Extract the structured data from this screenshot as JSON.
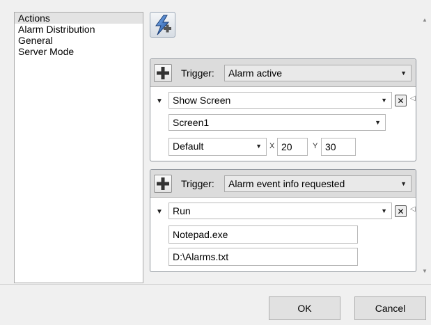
{
  "categories": [
    {
      "label": "Actions",
      "selected": true
    },
    {
      "label": "Alarm Distribution",
      "selected": false
    },
    {
      "label": "General",
      "selected": false
    },
    {
      "label": "Server Mode",
      "selected": false
    }
  ],
  "icons": {
    "add_action": "lightning-plus-icon",
    "add_trigger": "plus-icon",
    "delete": "close-icon",
    "collapse": "triangle-down-icon",
    "dropdown": "triangle-down-icon",
    "scroll_up": "triangle-up-icon",
    "scroll_down": "triangle-down-icon"
  },
  "triggers": [
    {
      "label": "Trigger:",
      "value": "Alarm active",
      "action": {
        "type": "Show Screen",
        "screen": "Screen1",
        "position": "Default",
        "x_label": "X",
        "x_value": "20",
        "y_label": "Y",
        "y_value": "30"
      }
    },
    {
      "label": "Trigger:",
      "value": "Alarm event info requested",
      "action": {
        "type": "Run",
        "program": "Notepad.exe",
        "arguments": "D:\\Alarms.txt"
      }
    }
  ],
  "footer": {
    "ok_label": "OK",
    "cancel_label": "Cancel"
  },
  "colors": {
    "window_bg": "#f0f0f0",
    "panel_header": "#dcdcdc",
    "selection": "#e3e3e3"
  }
}
